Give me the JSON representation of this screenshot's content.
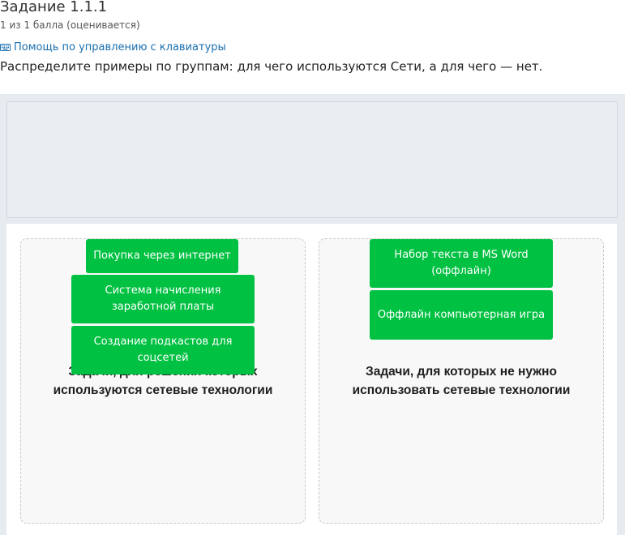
{
  "header": {
    "title": "Задание 1.1.1",
    "score": "1 из 1 балла (оценивается)",
    "keyboard_help": "Помощь по управлению с клавиатуры",
    "keyboard_icon": "keyboard-icon"
  },
  "instruction": "Распределите примеры по группам: для чего используются Сети, а для чего — нет.",
  "zones": {
    "left": {
      "label": "Задачи, для решения которых используются сетевые технологии",
      "items": [
        "Покупка через интернет",
        "Система начисления заработной платы",
        "Создание подкастов для соцсетей"
      ]
    },
    "right": {
      "label": "Задачи, для которых не нужно использовать сетевые технологии",
      "items": [
        "Набор текста в MS Word (оффлайн)",
        "Оффлайн компьютерная игра"
      ]
    }
  },
  "colors": {
    "chip": "#00c141",
    "link": "#1a6fb0",
    "workspace_bg": "#e6ebf0"
  }
}
